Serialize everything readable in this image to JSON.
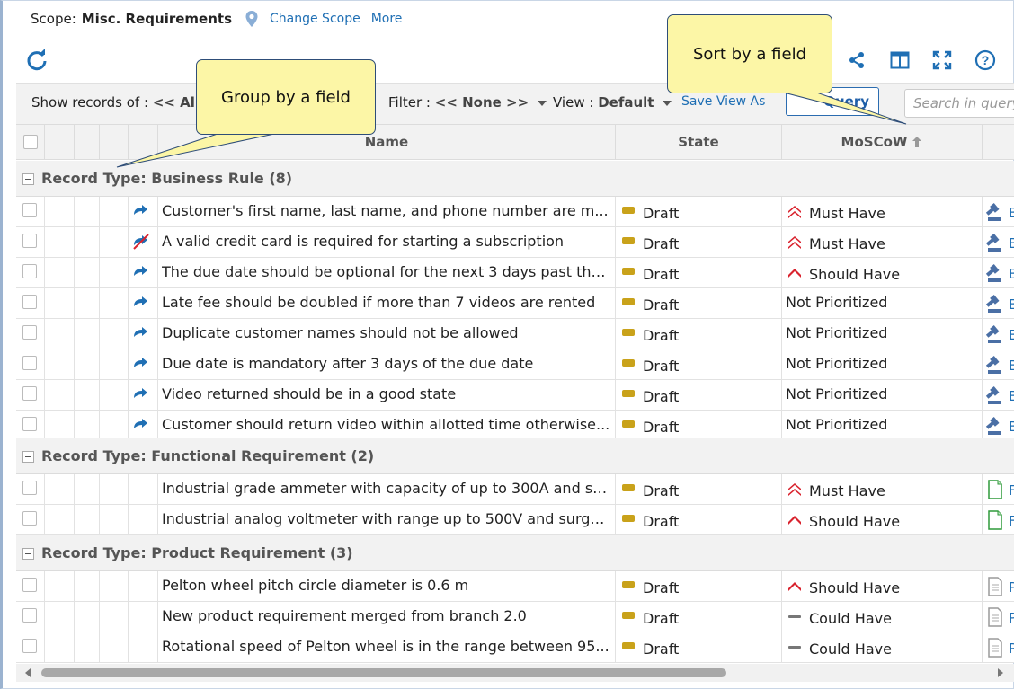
{
  "scope": {
    "label": "Scope:",
    "value": "Misc. Requirements",
    "change_scope": "Change Scope",
    "more": "More"
  },
  "toolbar": {
    "icons": [
      "refresh-icon",
      "share-icon",
      "columns-icon",
      "fullscreen-icon",
      "help-icon"
    ]
  },
  "filterbar": {
    "show_records_label": "Show records of :",
    "show_records_value": "<< All R",
    "filter_label": "Filter :",
    "filter_value": "<< None >>",
    "view_label": "View :",
    "view_value": "Default",
    "save_view_as": "Save View As",
    "query_button": "Query",
    "search_placeholder": "Search in query"
  },
  "columns": {
    "name": "Name",
    "state": "State",
    "moscow": "MoSCoW"
  },
  "groups": [
    {
      "title": "Record Type: Business Rule (8)",
      "rows": [
        {
          "name": "Customer's first name, last name, and phone number are m...",
          "state": "Draft",
          "moscow": "Must Have",
          "type_icon": "link-icon"
        },
        {
          "name": "A valid credit card is required for starting a subscription",
          "state": "Draft",
          "moscow": "Must Have",
          "type_icon": "broken-link-icon"
        },
        {
          "name": "The due date should be optional for the next 3 days past the ...",
          "state": "Draft",
          "moscow": "Should Have",
          "type_icon": "link-icon"
        },
        {
          "name": "Late fee should be doubled if more than 7 videos are rented",
          "state": "Draft",
          "moscow": "Not Prioritized",
          "type_icon": "link-icon"
        },
        {
          "name": "Duplicate customer names should not be allowed",
          "state": "Draft",
          "moscow": "Not Prioritized",
          "type_icon": "link-icon"
        },
        {
          "name": "Due date is mandatory after 3 days of the due date",
          "state": "Draft",
          "moscow": "Not Prioritized",
          "type_icon": "link-icon"
        },
        {
          "name": "Video returned should be in a good state",
          "state": "Draft",
          "moscow": "Not Prioritized",
          "type_icon": "link-icon"
        },
        {
          "name": "Customer should return video within allotted time otherwise...",
          "state": "Draft",
          "moscow": "Not Prioritized",
          "type_icon": "link-icon"
        }
      ]
    },
    {
      "title": "Record Type: Functional Requirement (2)",
      "rows": [
        {
          "name": "Industrial grade ammeter with capacity of up to 300A and su...",
          "state": "Draft",
          "moscow": "Must Have",
          "type_icon": ""
        },
        {
          "name": "Industrial analog voltmeter with range up to 500V and surge ...",
          "state": "Draft",
          "moscow": "Should Have",
          "type_icon": ""
        }
      ]
    },
    {
      "title": "Record Type: Product Requirement (3)",
      "rows": [
        {
          "name": "Pelton wheel pitch circle diameter is 0.6 m",
          "state": "Draft",
          "moscow": "Should Have",
          "type_icon": ""
        },
        {
          "name": "New product requirement merged from branch 2.0",
          "state": "Draft",
          "moscow": "Could Have",
          "type_icon": ""
        },
        {
          "name": "Rotational speed of Pelton wheel is in the range between 95...",
          "state": "Draft",
          "moscow": "Could Have",
          "type_icon": ""
        }
      ]
    }
  ],
  "callouts": {
    "group_by": "Group by a field",
    "sort_by": "Sort by a field"
  },
  "colors": {
    "link": "#1f6fb4",
    "header_bg": "#f2f2f2",
    "draft": "#c9a21a",
    "priority_red": "#d9232e",
    "callout_bg": "#fcf6a6"
  }
}
